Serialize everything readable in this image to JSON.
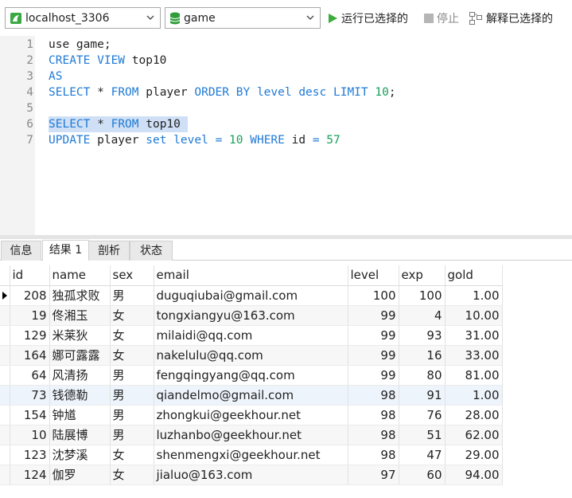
{
  "toolbar": {
    "connection": "localhost_3306",
    "database": "game",
    "run_selected": "运行已选择的",
    "stop": "停止",
    "explain_selected": "解释已选择的"
  },
  "editor": {
    "line_numbers": [
      "1",
      "2",
      "3",
      "4",
      "5",
      "6",
      "7"
    ],
    "lines": [
      [
        [
          "use game;",
          "plain"
        ]
      ],
      [
        [
          "CREATE VIEW",
          "kw"
        ],
        [
          " top10",
          "plain"
        ]
      ],
      [
        [
          "AS",
          "kw"
        ]
      ],
      [
        [
          "SELECT",
          "kw"
        ],
        [
          " ",
          "plain"
        ],
        [
          "*",
          "plain"
        ],
        [
          " ",
          "plain"
        ],
        [
          "FROM",
          "kw"
        ],
        [
          " player ",
          "plain"
        ],
        [
          "ORDER BY",
          "kw"
        ],
        [
          " ",
          "plain"
        ],
        [
          "level",
          "kw"
        ],
        [
          " ",
          "plain"
        ],
        [
          "desc",
          "kw"
        ],
        [
          " ",
          "plain"
        ],
        [
          "LIMIT",
          "kw"
        ],
        [
          " ",
          "plain"
        ],
        [
          "10",
          "num"
        ],
        [
          ";",
          "plain"
        ]
      ],
      [],
      [
        [
          "SELECT",
          "kw"
        ],
        [
          " ",
          "plain"
        ],
        [
          "*",
          "plain"
        ],
        [
          " ",
          "plain"
        ],
        [
          "FROM",
          "kw"
        ],
        [
          " top10 ",
          "plain"
        ]
      ],
      [
        [
          "UPDATE",
          "kw"
        ],
        [
          " player ",
          "plain"
        ],
        [
          "set",
          "kw"
        ],
        [
          " ",
          "plain"
        ],
        [
          "level",
          "kw"
        ],
        [
          " ",
          "plain"
        ],
        [
          "=",
          "op"
        ],
        [
          " ",
          "plain"
        ],
        [
          "10",
          "num"
        ],
        [
          " ",
          "plain"
        ],
        [
          "WHERE",
          "kw"
        ],
        [
          " id ",
          "plain"
        ],
        [
          "=",
          "op"
        ],
        [
          " ",
          "plain"
        ],
        [
          "57",
          "num"
        ]
      ]
    ]
  },
  "tabs": [
    "信息",
    "结果 1",
    "剖析",
    "状态"
  ],
  "results": {
    "columns": [
      "id",
      "name",
      "sex",
      "email",
      "level",
      "exp",
      "gold"
    ],
    "rows": [
      [
        "208",
        "独孤求败",
        "男",
        "duguqiubai@gmail.com",
        "100",
        "100",
        "1.00"
      ],
      [
        "19",
        "佟湘玉",
        "女",
        "tongxiangyu@163.com",
        "99",
        "4",
        "10.00"
      ],
      [
        "129",
        "米莱狄",
        "女",
        "milaidi@qq.com",
        "99",
        "93",
        "31.00"
      ],
      [
        "164",
        "娜可露露",
        "女",
        "nakelulu@qq.com",
        "99",
        "16",
        "33.00"
      ],
      [
        "64",
        "风清扬",
        "男",
        "fengqingyang@qq.com",
        "99",
        "80",
        "81.00"
      ],
      [
        "73",
        "钱德勒",
        "男",
        "qiandelmo@gmail.com",
        "98",
        "91",
        "1.00"
      ],
      [
        "154",
        "钟馗",
        "男",
        "zhongkui@geekhour.net",
        "98",
        "76",
        "28.00"
      ],
      [
        "10",
        "陆展博",
        "男",
        "luzhanbo@geekhour.net",
        "98",
        "51",
        "62.00"
      ],
      [
        "123",
        "沈梦溪",
        "女",
        "shenmengxi@geekhour.net",
        "98",
        "47",
        "29.00"
      ],
      [
        "124",
        "伽罗",
        "女",
        "jialuo@163.com",
        "97",
        "60",
        "94.00"
      ]
    ]
  },
  "colors": {
    "keyword": "#1f7ad6",
    "number": "#18a05b",
    "selection": "#cfe0f6",
    "run_icon": "#3dab3d",
    "db_icon": "#2f9e3a"
  },
  "icons": {
    "connection": "mysql-connection-icon",
    "database": "database-icon",
    "run": "play-icon",
    "stop": "stop-icon",
    "explain": "explain-icon"
  }
}
